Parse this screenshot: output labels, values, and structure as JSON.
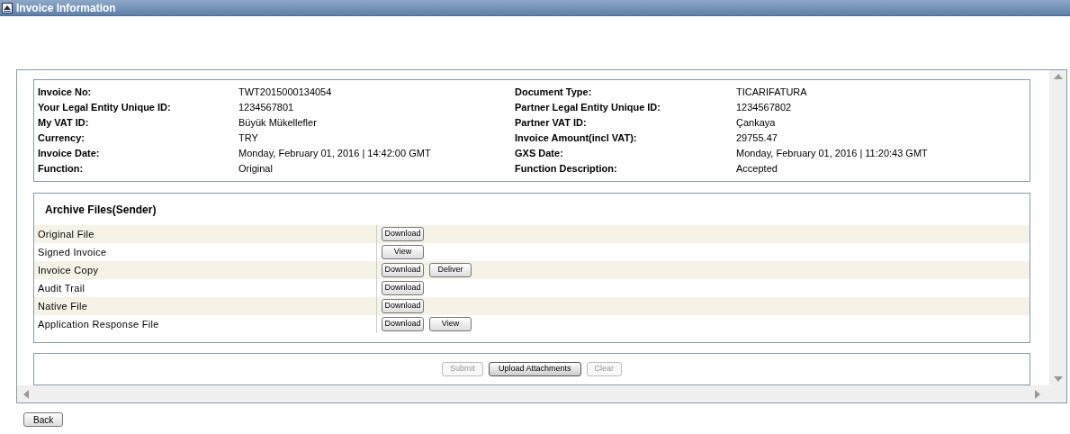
{
  "window": {
    "title": "Invoice Information"
  },
  "invoice_fields": [
    {
      "label": "Invoice No:",
      "value": "TWT2015000134054",
      "label_2": "Document Type:",
      "value_2": "TICARIFATURA"
    },
    {
      "label": "Your Legal Entity Unique ID:",
      "value": "1234567801",
      "label_2": "Partner Legal Entity Unique ID:",
      "value_2": "1234567802"
    },
    {
      "label": "My VAT ID:",
      "value": "Büyük Mükellefler",
      "label_2": "Partner VAT ID:",
      "value_2": "Çankaya"
    },
    {
      "label": "Currency:",
      "value": "TRY",
      "label_2": "Invoice Amount(incl VAT):",
      "value_2": "29755.47"
    },
    {
      "label": "Invoice Date:",
      "value": "Monday, February 01, 2016 | 14:42:00 GMT",
      "label_2": "GXS Date:",
      "value_2": "Monday, February 01, 2016 | 11:20:43 GMT"
    },
    {
      "label": "Function:",
      "value": "Original",
      "label_2": "Function Description:",
      "value_2": "Accepted"
    }
  ],
  "archive_files": {
    "title": "Archive Files(Sender)",
    "rows": [
      {
        "name": "Original File",
        "buttons": [
          "Download"
        ]
      },
      {
        "name": "Signed Invoice",
        "buttons": [
          "View"
        ]
      },
      {
        "name": "Invoice Copy",
        "buttons": [
          "Download",
          "Deliver"
        ]
      },
      {
        "name": "Audit Trail",
        "buttons": [
          "Download"
        ]
      },
      {
        "name": "Native File",
        "buttons": [
          "Download"
        ]
      },
      {
        "name": "Application Response File",
        "buttons": [
          "Download",
          "View"
        ]
      }
    ]
  },
  "actions": [
    {
      "label": "Submit",
      "disabled": true
    },
    {
      "label": "Upload Attachments",
      "disabled": false
    },
    {
      "label": "Clear",
      "disabled": true
    }
  ],
  "back_button": "Back"
}
